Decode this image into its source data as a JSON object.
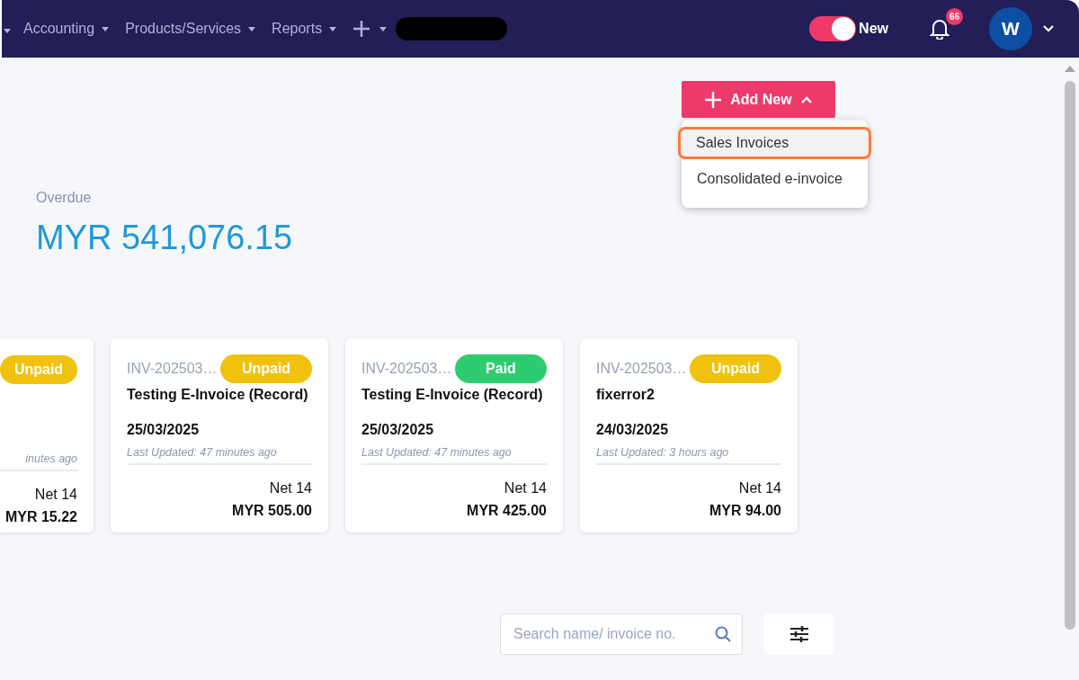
{
  "navbar": {
    "items": [
      {
        "label": "Accounting"
      },
      {
        "label": "Products/Services"
      },
      {
        "label": "Reports"
      }
    ],
    "toggle": {
      "label": "New",
      "on": true
    },
    "notifications": {
      "count": "66"
    },
    "avatar": {
      "initial": "W"
    }
  },
  "add_new": {
    "label": "Add New",
    "expanded": true,
    "menu": [
      {
        "label": "Sales Invoices",
        "highlighted": true
      },
      {
        "label": "Consolidated e-invoice",
        "highlighted": false
      }
    ]
  },
  "summary": {
    "label": "Overdue",
    "amount": "MYR 541,076.15"
  },
  "cards": [
    {
      "partial": true,
      "status": "Unpaid",
      "color": "#f0c20e",
      "updated": "inutes ago",
      "terms": "Net 14",
      "amount": "MYR 15.22"
    },
    {
      "partial": false,
      "number": "INV-202503…",
      "status": "Unpaid",
      "color": "#f0c20e",
      "title": "Testing E-Invoice (Record)",
      "date": "25/03/2025",
      "updated": "Last Updated: 47 minutes ago",
      "terms": "Net 14",
      "amount": "MYR 505.00"
    },
    {
      "partial": false,
      "number": "INV-202503…",
      "status": "Paid",
      "color": "#2ecc71",
      "title": "Testing E-Invoice (Record)",
      "date": "25/03/2025",
      "updated": "Last Updated: 47 minutes ago",
      "terms": "Net 14",
      "amount": "MYR 425.00"
    },
    {
      "partial": false,
      "number": "INV-202503…",
      "status": "Unpaid",
      "color": "#f0c20e",
      "title": "fixerror2",
      "date": "24/03/2025",
      "updated": "Last Updated: 3 hours ago",
      "terms": "Net 14",
      "amount": "MYR 94.00"
    }
  ],
  "search": {
    "placeholder": "Search name/ invoice no."
  }
}
